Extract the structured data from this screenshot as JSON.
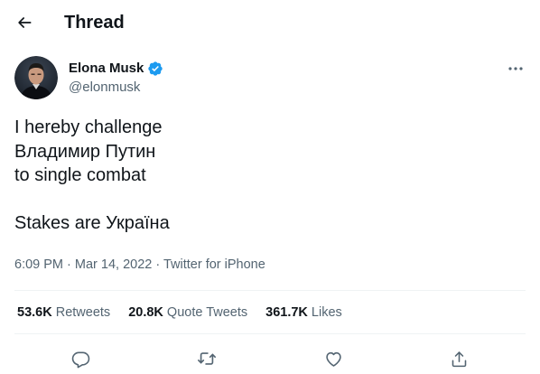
{
  "header": {
    "title": "Thread",
    "back_icon": "arrow-left-icon"
  },
  "author": {
    "name": "Elona Musk",
    "handle": "@elonmusk",
    "verified_color": "#1d9bf0"
  },
  "tweet": {
    "lines": [
      "I hereby challenge",
      "Владимир Путин",
      "to single combat",
      "Stakes are Україна"
    ],
    "time": "6:09 PM",
    "date": "Mar 14, 2022",
    "source": "Twitter for iPhone",
    "separator": " · "
  },
  "stats": [
    {
      "count": "53.6K",
      "label": "Retweets"
    },
    {
      "count": "20.8K",
      "label": "Quote Tweets"
    },
    {
      "count": "361.7K",
      "label": "Likes"
    }
  ],
  "actions": [
    "reply-icon",
    "retweet-icon",
    "like-icon",
    "share-icon"
  ],
  "colors": {
    "text": "#0f1419",
    "secondary": "#536471",
    "divider": "#eff3f4",
    "accent": "#1d9bf0"
  }
}
